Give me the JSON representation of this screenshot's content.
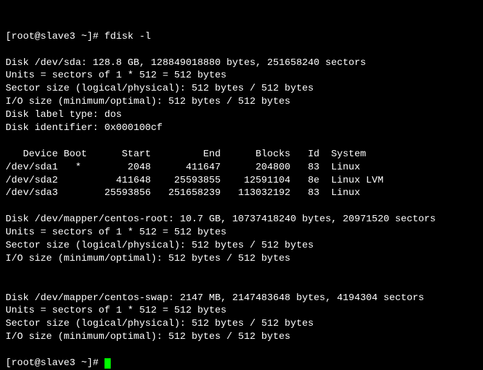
{
  "prompt1": "[root@slave3 ~]# ",
  "cmd": "fdisk -l",
  "empty": "",
  "disk1": {
    "header": "Disk /dev/sda: 128.8 GB, 128849018880 bytes, 251658240 sectors",
    "units": "Units = sectors of 1 * 512 = 512 bytes",
    "sector": "Sector size (logical/physical): 512 bytes / 512 bytes",
    "io": "I/O size (minimum/optimal): 512 bytes / 512 bytes",
    "label": "Disk label type: dos",
    "ident": "Disk identifier: 0x000100cf"
  },
  "table": {
    "header": "   Device Boot      Start         End      Blocks   Id  System",
    "r1": "/dev/sda1   *        2048      411647      204800   83  Linux",
    "r2": "/dev/sda2          411648    25593855    12591104   8e  Linux LVM",
    "r3": "/dev/sda3        25593856   251658239   113032192   83  Linux"
  },
  "disk2": {
    "header": "Disk /dev/mapper/centos-root: 10.7 GB, 10737418240 bytes, 20971520 sectors",
    "units": "Units = sectors of 1 * 512 = 512 bytes",
    "sector": "Sector size (logical/physical): 512 bytes / 512 bytes",
    "io": "I/O size (minimum/optimal): 512 bytes / 512 bytes"
  },
  "disk3": {
    "header": "Disk /dev/mapper/centos-swap: 2147 MB, 2147483648 bytes, 4194304 sectors",
    "units": "Units = sectors of 1 * 512 = 512 bytes",
    "sector": "Sector size (logical/physical): 512 bytes / 512 bytes",
    "io": "I/O size (minimum/optimal): 512 bytes / 512 bytes"
  },
  "prompt2": "[root@slave3 ~]# "
}
